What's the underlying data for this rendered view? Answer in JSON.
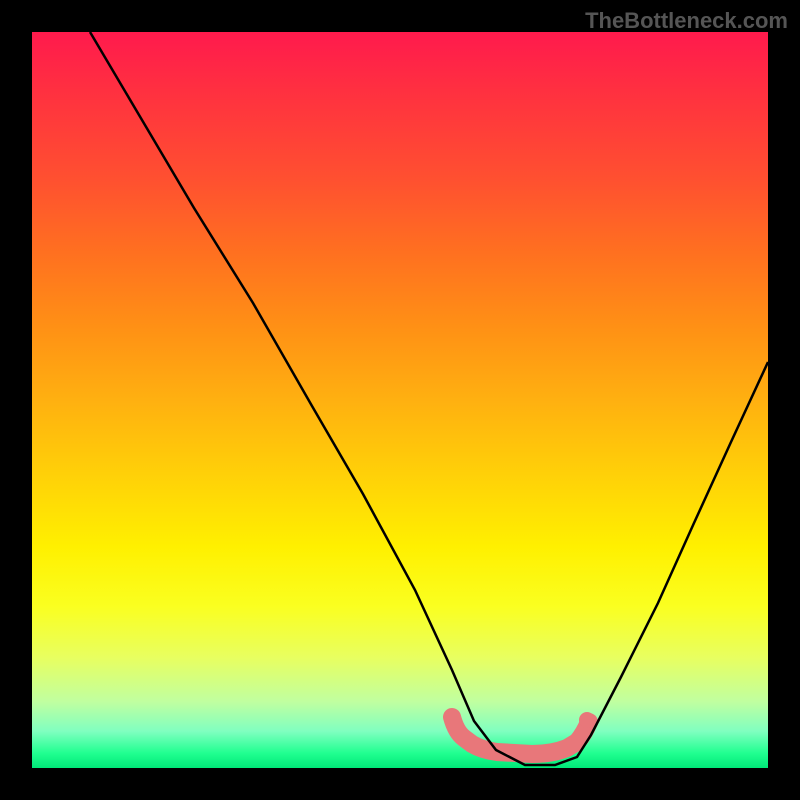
{
  "watermark": "TheBottleneck.com",
  "chart_data": {
    "type": "line",
    "title": "",
    "xlabel": "",
    "ylabel": "",
    "xlim": [
      0,
      100
    ],
    "ylim": [
      0,
      100
    ],
    "series": [
      {
        "name": "bottleneck-curve",
        "x": [
          8,
          15,
          22,
          30,
          38,
          45,
          52,
          57,
          60,
          63,
          67,
          71,
          74,
          76,
          80,
          85,
          90,
          95,
          100
        ],
        "values": [
          100,
          88,
          76,
          63,
          49,
          37,
          24,
          13,
          6,
          2,
          0,
          0,
          1,
          4,
          12,
          22,
          33,
          44,
          55
        ]
      }
    ],
    "annotations": [
      {
        "name": "optimal-zone-marker",
        "x_range": [
          57,
          75
        ],
        "y": 1,
        "color": "#e8777a"
      }
    ],
    "background_gradient": {
      "top": "#ff1a4d",
      "middle": "#fff000",
      "bottom": "#00e878"
    }
  }
}
